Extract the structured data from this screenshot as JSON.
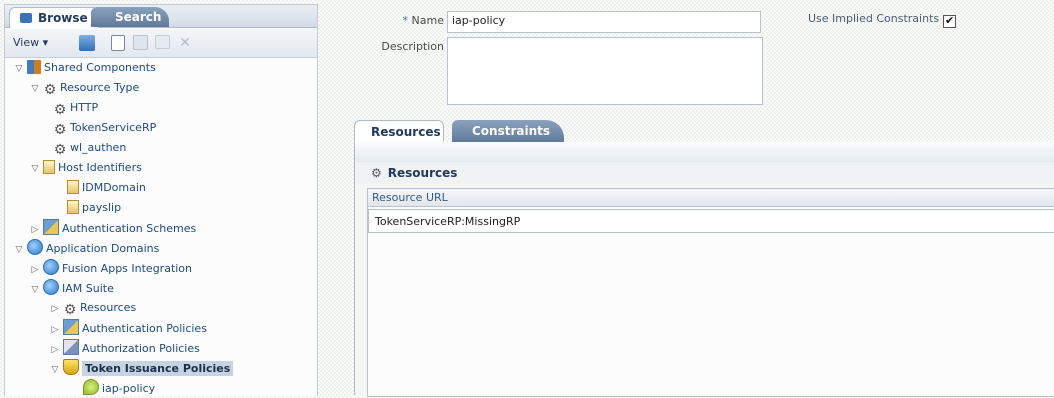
{
  "left": {
    "tabs": {
      "browse": "Browse",
      "search": "Search"
    },
    "toolbar": {
      "view_label": "View ▾"
    },
    "tree": [
      {
        "label": "Shared Components",
        "exp": "▽",
        "icon": "shared-components-icon"
      },
      {
        "label": "Resource Type",
        "exp": "▽",
        "icon": "gear-icon"
      },
      {
        "label": "HTTP",
        "exp": "",
        "icon": "gear-icon"
      },
      {
        "label": "TokenServiceRP",
        "exp": "",
        "icon": "gear-icon"
      },
      {
        "label": "wl_authen",
        "exp": "",
        "icon": "gear-icon"
      },
      {
        "label": "Host Identifiers",
        "exp": "▽",
        "icon": "document-icon"
      },
      {
        "label": "IDMDomain",
        "exp": "",
        "icon": "document-icon"
      },
      {
        "label": "payslip",
        "exp": "",
        "icon": "document-icon"
      },
      {
        "label": "Authentication Schemes",
        "exp": "▷",
        "icon": "authentication-scheme-icon"
      },
      {
        "label": "Application Domains",
        "exp": "▽",
        "icon": "globe-icon"
      },
      {
        "label": "Fusion Apps Integration",
        "exp": "▷",
        "icon": "globe-icon"
      },
      {
        "label": "IAM Suite",
        "exp": "▽",
        "icon": "globe-icon"
      },
      {
        "label": "Resources",
        "exp": "▷",
        "icon": "gear-icon"
      },
      {
        "label": "Authentication Policies",
        "exp": "▷",
        "icon": "authentication-policy-icon"
      },
      {
        "label": "Authorization Policies",
        "exp": "▷",
        "icon": "authorization-policy-icon"
      },
      {
        "label": "Token Issuance Policies",
        "exp": "▽",
        "icon": "shield-icon",
        "selected": true
      },
      {
        "label": "iap-policy",
        "exp": "",
        "icon": "policy-leaf-icon"
      }
    ]
  },
  "form": {
    "name_label": "Name",
    "name_required_mark": "*",
    "name_value": "iap-policy",
    "description_label": "Description",
    "description_value": "",
    "implied_label": "Use Implied Constraints",
    "implied_checked": "✔"
  },
  "right_tabs": {
    "resources": "Resources",
    "constraints": "Constraints"
  },
  "resources_section": {
    "title": "Resources",
    "column_header": "Resource URL",
    "rows": [
      "TokenServiceRP:MissingRP"
    ]
  }
}
